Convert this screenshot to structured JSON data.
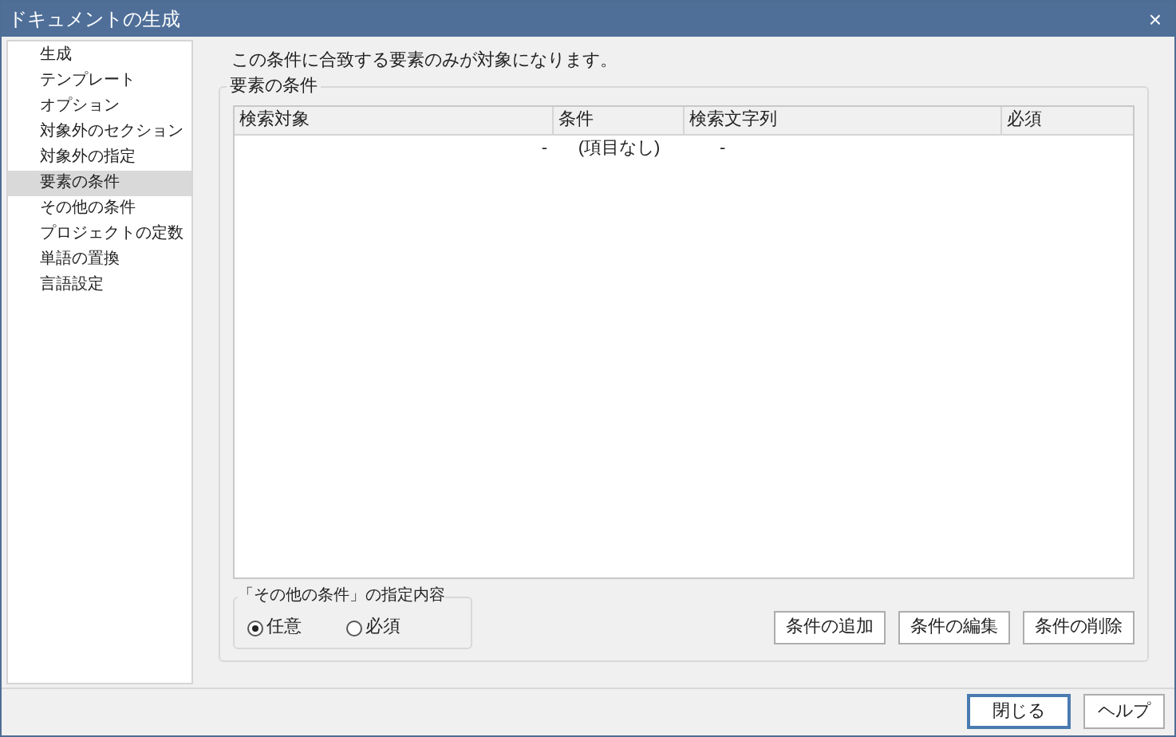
{
  "window": {
    "title": "ドキュメントの生成",
    "close": "×"
  },
  "sidebar": {
    "items": [
      {
        "label": "生成",
        "selected": false
      },
      {
        "label": "テンプレート",
        "selected": false
      },
      {
        "label": "オプション",
        "selected": false
      },
      {
        "label": "対象外のセクション",
        "selected": false
      },
      {
        "label": "対象外の指定",
        "selected": false
      },
      {
        "label": "要素の条件",
        "selected": true
      },
      {
        "label": "その他の条件",
        "selected": false
      },
      {
        "label": "プロジェクトの定数",
        "selected": false
      },
      {
        "label": "単語の置換",
        "selected": false
      },
      {
        "label": "言語設定",
        "selected": false
      }
    ]
  },
  "description": "この条件に合致する要素のみが対象になります。",
  "group": {
    "title": "要素の条件",
    "table": {
      "columns": [
        "検索対象",
        "条件",
        "検索文字列",
        "必須"
      ],
      "rows": [
        [
          "-",
          "(項目なし)",
          "-",
          ""
        ]
      ]
    },
    "mode": {
      "title": "「その他の条件」の指定内容",
      "options": [
        {
          "label": "任意",
          "selected": true
        },
        {
          "label": "必須",
          "selected": false
        }
      ]
    },
    "buttons": [
      "条件の追加",
      "条件の編集",
      "条件の削除"
    ]
  },
  "footer_buttons": [
    {
      "label": "閉じる",
      "default": true
    },
    {
      "label": "ヘルプ",
      "default": false
    }
  ]
}
